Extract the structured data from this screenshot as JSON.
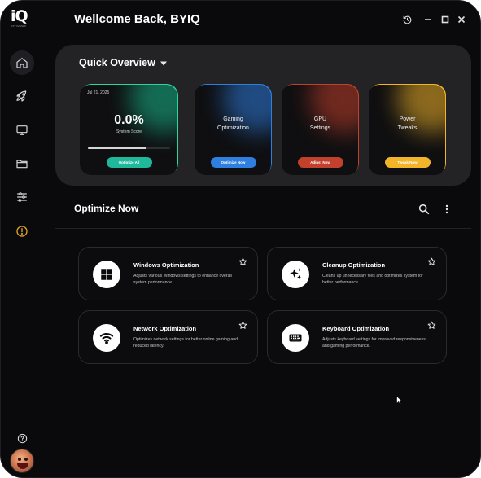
{
  "header": {
    "title": "Wellcome Back, BYIQ"
  },
  "logo": {
    "mark": "iQ",
    "sub": "OPTIMIZER"
  },
  "sidebar": {
    "items": [
      {
        "icon": "home-icon",
        "active": true
      },
      {
        "icon": "rocket-icon",
        "active": false
      },
      {
        "icon": "monitor-icon",
        "active": false
      },
      {
        "icon": "folder-icon",
        "active": false
      },
      {
        "icon": "sliders-icon",
        "active": false
      },
      {
        "icon": "alert-icon",
        "active": false
      }
    ],
    "help_icon": "help-icon"
  },
  "overview": {
    "title": "Quick Overview",
    "system_card": {
      "date": "Jul 21, 2025",
      "score": "0.0%",
      "score_label": "System Score",
      "score_progress": 0.7,
      "button": "Optimize All",
      "color": "#1fb89a"
    },
    "cards": [
      {
        "line1": "Gaming",
        "line2": "Optimization",
        "button": "Optimize Now",
        "color": "#2f7fe0"
      },
      {
        "line1": "GPU",
        "line2": "Settings",
        "button": "Adjust Now",
        "color": "#c2402c"
      },
      {
        "line1": "Power",
        "line2": "Tweaks",
        "button": "Tweak Now",
        "color": "#f2b52a"
      }
    ]
  },
  "optimize": {
    "title": "Optimize Now",
    "items": [
      {
        "name": "Windows Optimization",
        "desc": "Adjusts various Windows settings to enhance overall system performance.",
        "icon": "windows-icon"
      },
      {
        "name": "Cleanup Optimization",
        "desc": "Cleans up unnecessary files and optimizes system for better performance.",
        "icon": "sparkle-icon"
      },
      {
        "name": "Network Optimization",
        "desc": "Optimizes network settings for better online gaming and reduced latency.",
        "icon": "wifi-icon"
      },
      {
        "name": "Keyboard Optimization",
        "desc": "Adjusts keyboard settings for improved responsiveness and gaming performance.",
        "icon": "keyboard-icon"
      }
    ]
  }
}
